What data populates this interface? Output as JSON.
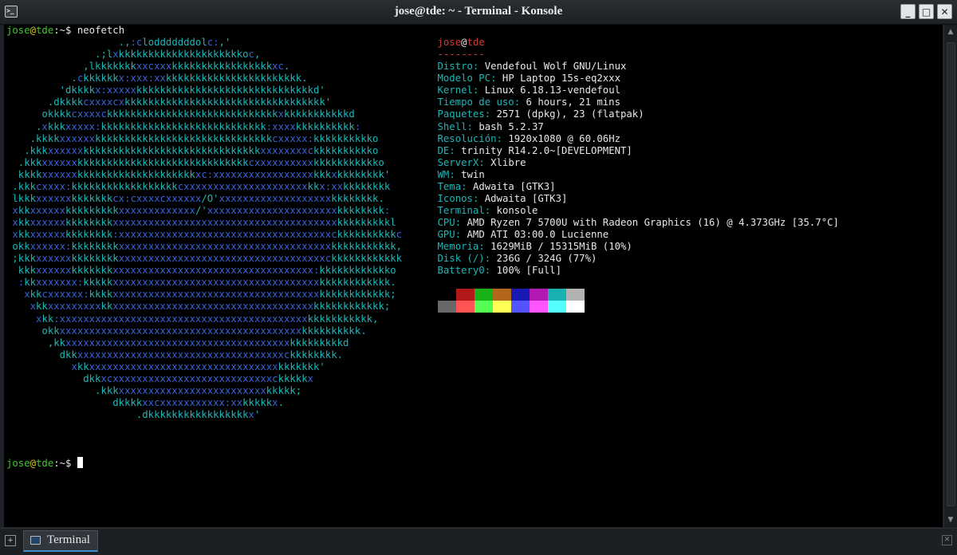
{
  "window": {
    "title": "jose@tde: ~ - Terminal - Konsole",
    "buttons": {
      "minimize": "✕",
      "maximize": "□",
      "close": "✕"
    }
  },
  "colors": {
    "prompt_user": "#3fc62f",
    "prompt_host": "#3fc62f",
    "at_sign": "#d8c12c",
    "logo_cyan": "#1cb7b8",
    "logo_blue": "#3a62d6",
    "info_key": "#1cb7b8",
    "info_user_host": "#cf3a3a",
    "tab_accent": "#3d8fd1"
  },
  "prompt": {
    "user": "jose",
    "at": "@",
    "host": "tde",
    "path": ":~$ ",
    "command": "neofetch"
  },
  "logo_lines": [
    "                   .,:clodddddddolc:,'",
    "               .;lxkkkkkkkkkkkkkkkkkkkkkoc,",
    "             ,lkkkkkkkxxcxxxkkkkkkkkkkkkkkkkkxc.",
    "           .ckkkkkkx:xxx:xxkkkkkkkkkkkkkkkkkkkkkkk.",
    "         'dkkkkx:xxxxxkkkkkkkkkkkkkkkkkkkkkkkkkkkkkkd'",
    "       .dkkkkcxxxxcxkkkkkkkkkkkkkkkkkkkkkkkkkkkkkkkkkk'",
    "      okkkkcxxxxckkkkkkkkkkkkkkkkkkkkkkkkkkkkkxkkkkkkkkkkkd",
    "     .xkkkxxxxx:kkkkkkkkkkkkkkkkkkkkkkkkkkkk:xxxxkkkkkkkkkk:",
    "    .kkkkxxxxxxkkkkkkkkkkkkkkkkkkkkkkkkkkkkkkcxxxxx:kkkkkkkkkko",
    "   .kkkxxxxxxkkkkkkkkkkkkkkkkkkkkkkkkkkkkkkxxxxxxxxckkkkkkkkkko",
    "  .kkkxxxxxxkkkkkkkkkkkkkkkkkkkkkkkkkkkkkcxxxxxxxxxxkkkkkkkkkkko",
    "  kkkkxxxxxxkkkkkkkkkkkkkkkkkkkkxc:xxxxxxxxxxxxxxxxxkkkxkkkkkkkk'",
    " .kkkcxxxx:kkkkkkkkkkkkkkkkkkcxxxxxxxxxxxxxxxxxxxxxkkx:xxkkkkkkkk",
    " lkkkxxxxxxkkkkkkkcx:cxxxxcxxxxxx/O'xxxxxxxxxxxxxxxxxxxkkkkkkkk.",
    " xkkxxxxxxkkkkkkkkkxxxxxxxxxxxxx/'xxxxxxxxxxxxxxxxxxxxxxkkkkkkkk:",
    " xkkxxxxxxkkkkkkkkxxxxxxxxxxxxxxxxxxxxxxxxxxxxxxxxxxxxxxkkkkkkkkkl",
    " xkkxxxxxxkkkkkkkk:xxxxxxxxxxxxxxxxxxxxxxxxxxxxxxxxxxxxckkkkkkkkkkc",
    " okkxxxxxx:kkkkkkkkxxxxxxxxxxxxxxxxxxxxxxxxxxxxxxxxxxxxkkkkkkkkkkk,",
    " ;kkkxxxxxxkkkkkkkkxxxxxxxxxxxxxxxxxxxxxxxxxxxxxxxxxxxckkkkkkkkkkkk",
    "  kkkxxxxxxkkkkkkkxxxxxxxxxxxxxxxxxxxxxxxxxxxxxxxxxx:kkkkkkkkkkkko",
    "  :kkxxxxxxx:kkkkkxxxxxxxxxxxxxxxxxxxxxxxxxxxxxxxxxxxkkkkkkkkkkkk.",
    "   xkkcxxxxxx:kkkkxxxxxxxxxxxxxxxxxxxxxxxxxxxxxxxxxxxkkkkkkkkkkkk;",
    "    xkkxxxxxxxxxkkxxxxxxxxxxxxxxxxxxxxxxxxxxxxxxxxxxkkkkkkkkkkkk;",
    "     xkk:xxxxxxxxxxxxxxxxxxxxxxxxxxxxxxxxxxxxxxxxxxkkkkkkkkkkk,",
    "      okkxxxxxxxxxxxxxxxxxxxxxxxxxxxxxxxxxxxxxxxxxkkkkkkkkkk.",
    "       ,kkxxxxxxxxxxxxxxxxxxxxxxxxxxxxxxxxxxxxxxkkkkkkkkkd",
    "         dkkxxxxxxxxxxxxxxxxxxxxxxxxxxxxxxxxxxxckkkkkkkk.",
    "           xkkxxxxxxxxxxxxxxxxxxxxxxxxxxxxxxxxkkkkkkk'",
    "             dkkxcxxxxxxxxxxxxxxxxxxxxxxxxxxxckkkkkx",
    "               .kkkxxxxxxxxxxxxxxxxxxxxxxxxxkkkkk;",
    "                  dkkkkxxcxxxxxxxxxxx:xxkkkkkx.",
    "                      .dkkkkkkkkkkkkkkkkkx'"
  ],
  "info": {
    "user": "jose",
    "at": "@",
    "host": "tde",
    "separator": "--------",
    "rows": [
      {
        "key": "Distro",
        "value": "Vendefoul Wolf GNU/Linux"
      },
      {
        "key": "Modelo PC",
        "value": "HP Laptop 15s-eq2xxx"
      },
      {
        "key": "Kernel",
        "value": "Linux 6.18.13-vendefoul"
      },
      {
        "key": "Tiempo de uso",
        "value": "6 hours, 21 mins"
      },
      {
        "key": "Paquetes",
        "value": "2571 (dpkg), 23 (flatpak)"
      },
      {
        "key": "Shell",
        "value": "bash 5.2.37"
      },
      {
        "key": "Resolución",
        "value": "1920x1080 @ 60.06Hz"
      },
      {
        "key": "DE",
        "value": "trinity R14.2.0~[DEVELOPMENT]"
      },
      {
        "key": "ServerX",
        "value": "Xlibre"
      },
      {
        "key": "WM",
        "value": "twin"
      },
      {
        "key": "Tema",
        "value": "Adwaita [GTK3]"
      },
      {
        "key": "Iconos",
        "value": "Adwaita [GTK3]"
      },
      {
        "key": "Terminal",
        "value": "konsole"
      },
      {
        "key": "CPU",
        "value": "AMD Ryzen 7 5700U with Radeon Graphics (16) @ 4.373GHz [35.7°C]"
      },
      {
        "key": "GPU",
        "value": "AMD ATI 03:00.0 Lucienne"
      },
      {
        "key": "Memoria",
        "value": "1629MiB / 15315MiB (10%)"
      },
      {
        "key": "Disk (/)",
        "value": "236G / 324G (77%)"
      },
      {
        "key": "Battery0",
        "value": "100% [Full]"
      }
    ],
    "palette_dark": [
      "#000000",
      "#b21818",
      "#18b218",
      "#b26818",
      "#1818b2",
      "#b218b2",
      "#18b2b2",
      "#b2b2b2"
    ],
    "palette_bright": [
      "#686868",
      "#ff5454",
      "#54ff54",
      "#ffff54",
      "#5454ff",
      "#ff54ff",
      "#54ffff",
      "#ffffff"
    ]
  },
  "tabbar": {
    "tab_label": "Terminal"
  }
}
